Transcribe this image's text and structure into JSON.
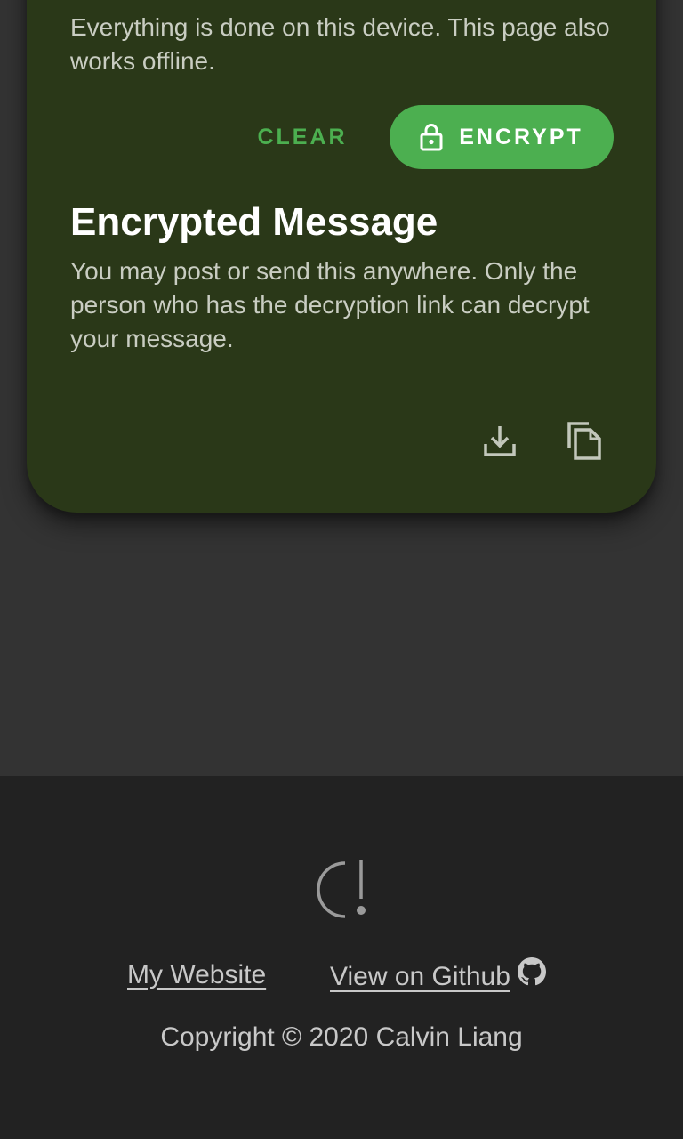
{
  "card": {
    "intro": "Everything is done on this device. This page also works offline.",
    "clear_label": "CLEAR",
    "encrypt_label": "ENCRYPT",
    "section_title": "Encrypted Message",
    "section_desc": "You may post or send this anywhere. Only the person who has the decryption link can decrypt your message.",
    "icons": {
      "lock": "lock-icon",
      "download": "download-icon",
      "copy": "copy-icon"
    }
  },
  "footer": {
    "links": {
      "website": "My Website",
      "github": "View on Github"
    },
    "copyright": "Copyright © 2020 Calvin Liang",
    "icons": {
      "logo": "logo-icon",
      "github": "github-icon"
    }
  },
  "colors": {
    "background": "#333333",
    "card": "#2a3818",
    "accent": "#4caf50",
    "footer": "#222222"
  }
}
